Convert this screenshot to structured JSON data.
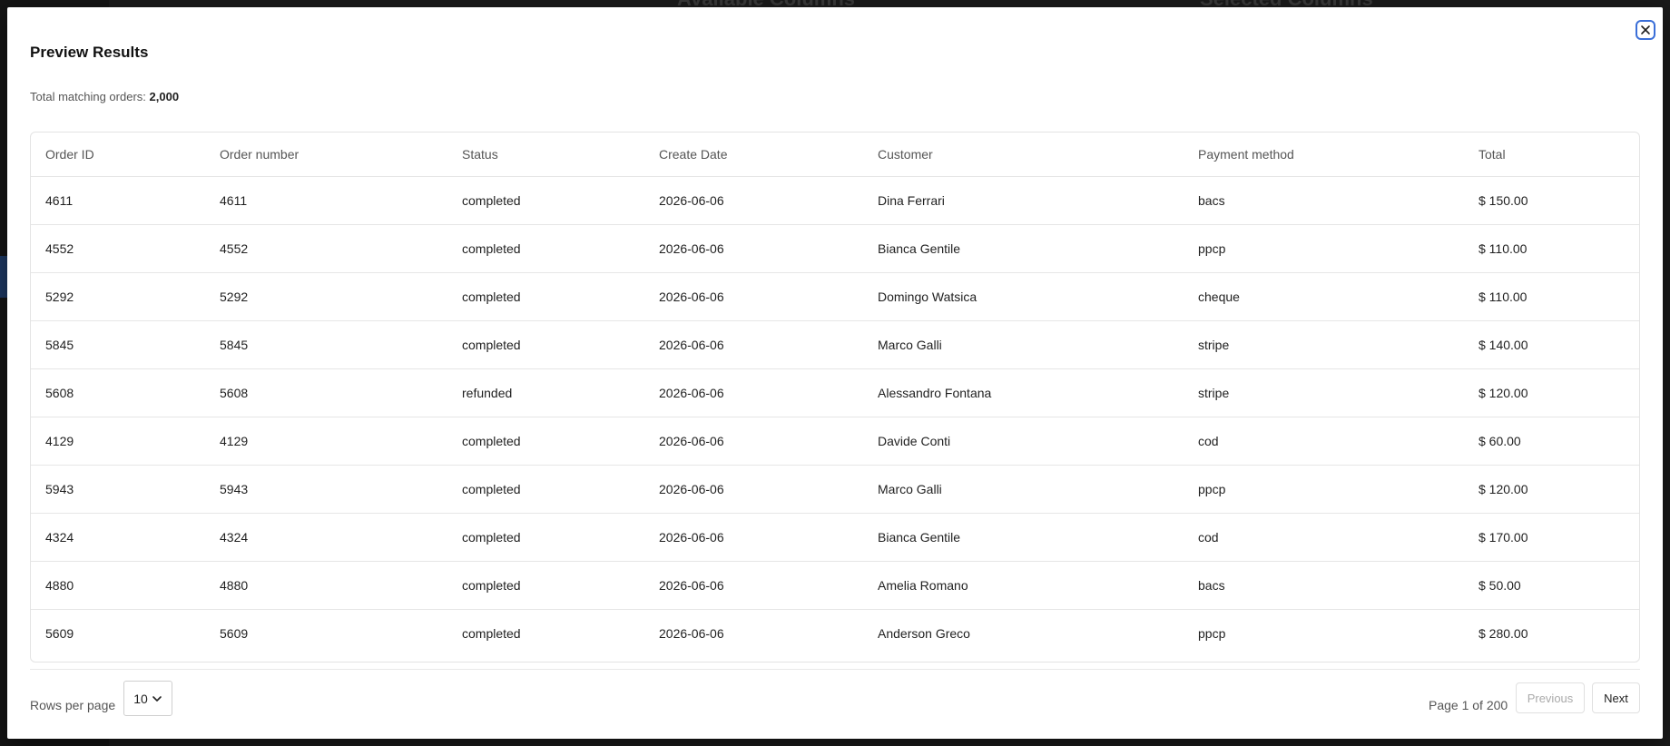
{
  "background": {
    "available_columns_title": "Available Columns",
    "selected_columns_title": "Selected Columns"
  },
  "modal": {
    "title": "Preview Results",
    "close_icon": "close-icon",
    "summary_label": "Total matching orders:",
    "summary_count": "2,000"
  },
  "table": {
    "columns": [
      "Order ID",
      "Order number",
      "Status",
      "Create Date",
      "Customer",
      "Payment method",
      "Total"
    ],
    "rows": [
      [
        "4611",
        "4611",
        "completed",
        "2026-06-06",
        "Dina Ferrari",
        "bacs",
        "$ 150.00"
      ],
      [
        "4552",
        "4552",
        "completed",
        "2026-06-06",
        "Bianca Gentile",
        "ppcp",
        "$ 110.00"
      ],
      [
        "5292",
        "5292",
        "completed",
        "2026-06-06",
        "Domingo Watsica",
        "cheque",
        "$ 110.00"
      ],
      [
        "5845",
        "5845",
        "completed",
        "2026-06-06",
        "Marco Galli",
        "stripe",
        "$ 140.00"
      ],
      [
        "5608",
        "5608",
        "refunded",
        "2026-06-06",
        "Alessandro Fontana",
        "stripe",
        "$ 120.00"
      ],
      [
        "4129",
        "4129",
        "completed",
        "2026-06-06",
        "Davide Conti",
        "cod",
        "$ 60.00"
      ],
      [
        "5943",
        "5943",
        "completed",
        "2026-06-06",
        "Marco Galli",
        "ppcp",
        "$ 120.00"
      ],
      [
        "4324",
        "4324",
        "completed",
        "2026-06-06",
        "Bianca Gentile",
        "cod",
        "$ 170.00"
      ],
      [
        "4880",
        "4880",
        "completed",
        "2026-06-06",
        "Amelia Romano",
        "bacs",
        "$ 50.00"
      ],
      [
        "5609",
        "5609",
        "completed",
        "2026-06-06",
        "Anderson Greco",
        "ppcp",
        "$ 280.00"
      ]
    ]
  },
  "footer": {
    "rows_per_page_label": "Rows per page",
    "rows_per_page_value": "10",
    "page_info": "Page 1 of 200",
    "previous_label": "Previous",
    "next_label": "Next"
  },
  "colors": {
    "accent": "#3b6fd8",
    "backdrop": "#101010"
  }
}
